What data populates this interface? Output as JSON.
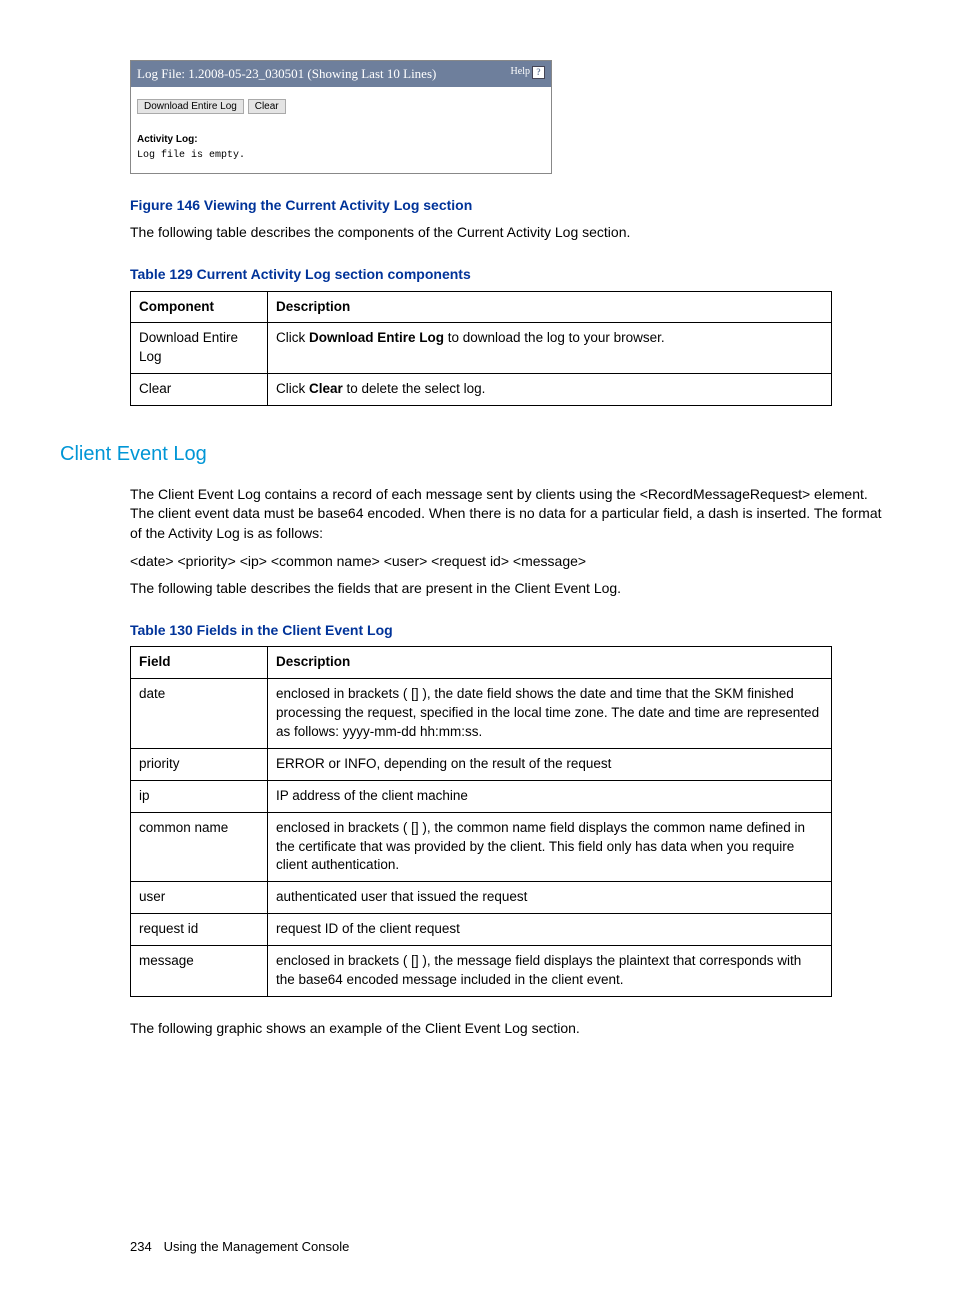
{
  "screenshot": {
    "header_title": "Log File: 1.2008-05-23_030501 (Showing Last 10 Lines)",
    "help_label": "Help",
    "qmark": "?",
    "btn_download": "Download Entire Log",
    "btn_clear": "Clear",
    "activity_label": "Activity Log:",
    "log_text": "Log file is empty."
  },
  "figure_caption": "Figure 146 Viewing the Current Activity Log section",
  "para1": "The following table describes the components of the Current Activity Log section.",
  "table129": {
    "caption": "Table 129 Current Activity Log section components",
    "h1": "Component",
    "h2": "Description",
    "r1c1": "Download Entire Log",
    "r1c2a": "Click ",
    "r1c2b": "Download Entire Log",
    "r1c2c": " to download the log to your browser.",
    "r2c1": "Clear",
    "r2c2a": "Click ",
    "r2c2b": "Clear",
    "r2c2c": " to delete the select log."
  },
  "section_title": "Client Event Log",
  "para2": "The Client Event Log contains a record of each message sent by clients using the <RecordMessageRequest> element.  The client event data must be base64 encoded.  When there is no data for a particular field, a dash is inserted.  The format of the Activity Log is as follows:",
  "format_line": "<date> <priority> <ip> <common name> <user> <request id> <message>",
  "para3": "The following table describes the fields that are present in the Client Event Log.",
  "table130": {
    "caption": "Table 130 Fields in the Client Event Log",
    "h1": "Field",
    "h2": "Description",
    "rows": {
      "r1c1": "date",
      "r1c2": "enclosed in brackets ( [] ), the date field shows the date and time that the SKM finished processing the request, specified in the local time zone.  The date and time are represented as follows:  yyyy-mm-dd hh:mm:ss.",
      "r2c1": "priority",
      "r2c2": "ERROR or INFO, depending on the result of the request",
      "r3c1": "ip",
      "r3c2": "IP address of the client machine",
      "r4c1": "common name",
      "r4c2": "enclosed in brackets ( [] ), the common name field displays the common name defined in the certificate that was provided by the client.  This field only has data when you require client authentication.",
      "r5c1": "user",
      "r5c2": "authenticated user that issued the request",
      "r6c1": "request id",
      "r6c2": "request ID of the client request",
      "r7c1": "message",
      "r7c2": "enclosed in brackets ( [] ), the message field displays the plaintext that corresponds with the base64 encoded message included in the client event."
    }
  },
  "para4": "The following graphic shows an example of the Client Event Log section.",
  "footer_page": "234",
  "footer_text": "Using the Management Console"
}
